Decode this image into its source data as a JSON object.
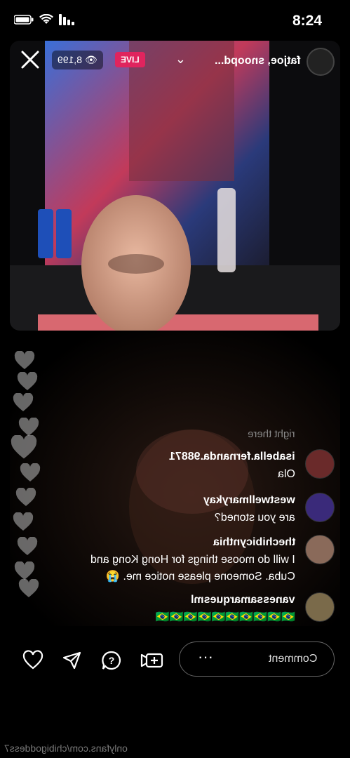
{
  "status_bar": {
    "time": "8:24"
  },
  "header": {
    "username": "fatjoe, snoopd...",
    "live_label": "LIVE",
    "viewer_count": "8,199"
  },
  "comments": {
    "faded_text": "right there",
    "items": [
      {
        "username": "isabella.fernanda.98871",
        "text": "Ola"
      },
      {
        "username": "westwellmarykay",
        "text": "are you stoned?"
      },
      {
        "username": "thechibicynthia",
        "text_lines": [
          "I will do moose things for Hong Kong and",
          "Cuba. Someone please notice me. 😭"
        ]
      },
      {
        "username": "vanessamarquesml",
        "text": "🇧🇷🇧🇷🇧🇷🇧🇷🇧🇷🇧🇷🇧🇷🇧🇷🇧🇷🇧🇷"
      }
    ]
  },
  "bottom_bar": {
    "comment_placeholder": "Comment",
    "more": "···"
  },
  "watermark": "onlyfans.com/chibigoddess7",
  "colors": {
    "live": "#e0245e",
    "background": "#000000"
  }
}
